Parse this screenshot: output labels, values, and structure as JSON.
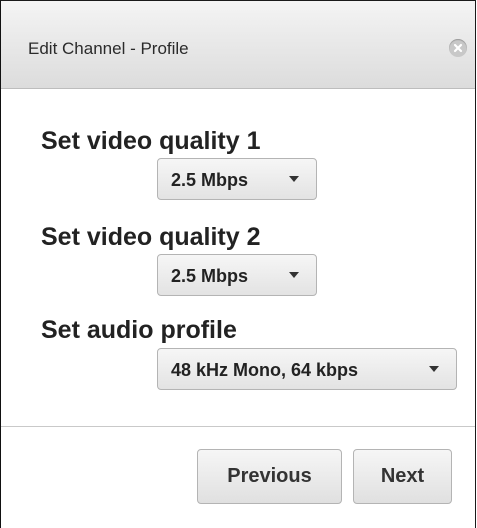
{
  "dialog": {
    "title": "Edit Channel - Profile",
    "close_icon": "close-circle-icon"
  },
  "fields": [
    {
      "label": "Set video quality 1",
      "value": "2.5 Mbps"
    },
    {
      "label": "Set video quality 2",
      "value": "2.5 Mbps"
    },
    {
      "label": "Set audio profile",
      "value": "48 kHz Mono, 64 kbps"
    }
  ],
  "buttons": {
    "previous": "Previous",
    "next": "Next"
  }
}
